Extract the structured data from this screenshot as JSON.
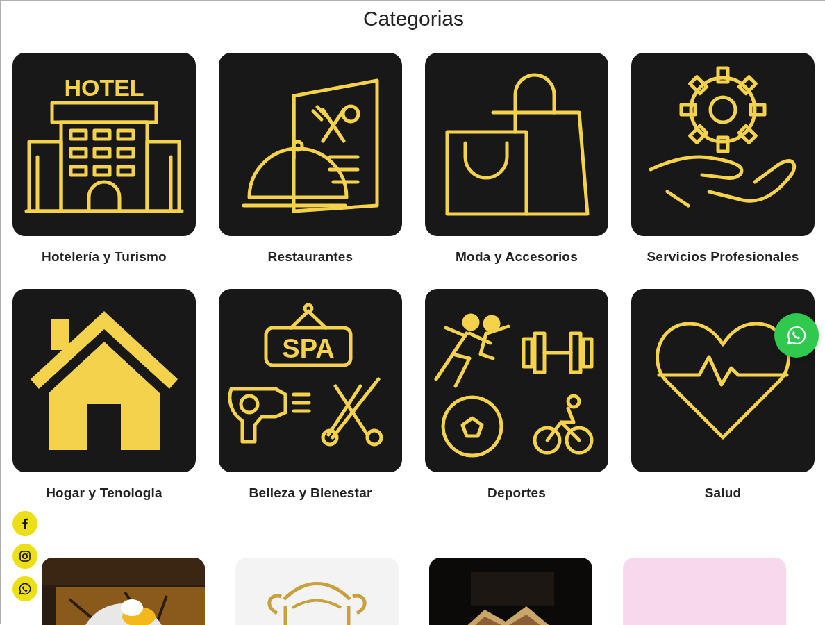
{
  "title": "Categorias",
  "categories": [
    {
      "label": "Hotelería y Turismo",
      "icon_text": "HOTEL"
    },
    {
      "label": "Restaurantes"
    },
    {
      "label": "Moda y Accesorios"
    },
    {
      "label": "Servicios Profesionales"
    },
    {
      "label": "Hogar y Tenologia"
    },
    {
      "label": "Belleza y Bienestar",
      "icon_text": "SPA"
    },
    {
      "label": "Deportes"
    },
    {
      "label": "Salud"
    }
  ]
}
